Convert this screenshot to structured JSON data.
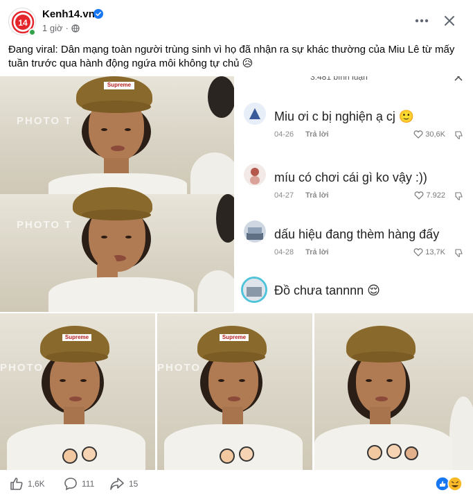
{
  "header": {
    "page_name": "Kenh14.vn",
    "time": "1 giờ",
    "logo_text": "14"
  },
  "caption": "Đang viral: Dân mạng toàn người trùng sinh vì họ đã nhận ra sự khác thường của Miu Lê từ mấy tuần trước qua hành động ngứa môi không tự chủ 😥",
  "comments": {
    "top_partial": "3.481 bình luận",
    "items": [
      {
        "text": "Miu ơi c bị nghiện ạ cj 🙂",
        "date": "04-26",
        "reply": "Trả lời",
        "likes": "30,6K"
      },
      {
        "text": "míu có chơi cái gì ko vậy :))",
        "date": "04-27",
        "reply": "Trả lời",
        "likes": "7.922"
      },
      {
        "text": "dấu hiệu đang thèm hàng đấy",
        "date": "04-28",
        "reply": "Trả lời",
        "likes": "13,7K"
      },
      {
        "text": "Đồ chưa tannnn 😌",
        "date": "",
        "reply": "",
        "likes": ""
      }
    ]
  },
  "photo_text": {
    "cap_logo": "Supreme",
    "wall_text": "PHOTO T"
  },
  "footer": {
    "likes": "1,6K",
    "comments": "111",
    "shares": "15"
  },
  "colors": {
    "verified": "#1877f2",
    "logo_red": "#e4262c",
    "online": "#31a24c"
  }
}
